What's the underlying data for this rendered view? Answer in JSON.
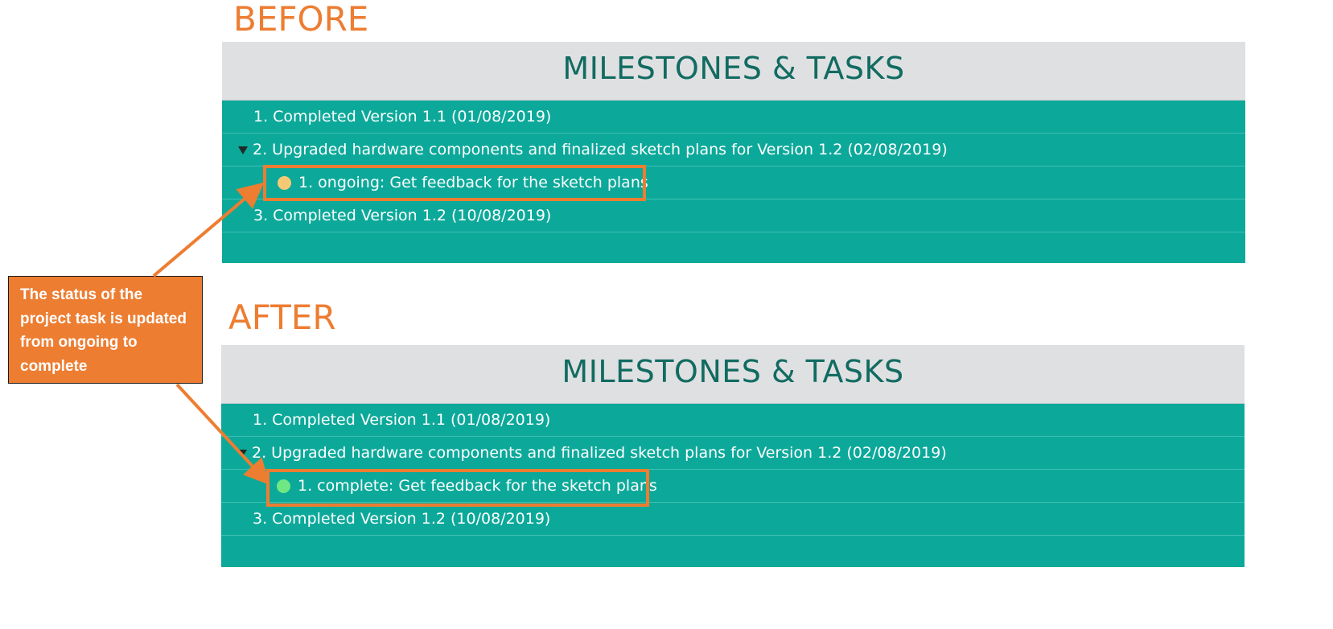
{
  "before": {
    "label": "BEFORE",
    "panel_title": "MILESTONES & TASKS",
    "rows": [
      {
        "text": "1. Completed Version 1.1 (01/08/2019)"
      },
      {
        "text": "2. Upgraded hardware components and finalized sketch plans for Version 1.2 (02/08/2019)",
        "expanded": true
      },
      {
        "text": "1. ongoing: Get feedback for the sketch plans",
        "status": "ongoing",
        "status_color": "#f8c974"
      },
      {
        "text": "3. Completed Version 1.2 (10/08/2019)"
      }
    ]
  },
  "after": {
    "label": "AFTER",
    "panel_title": "MILESTONES & TASKS",
    "rows": [
      {
        "text": "1. Completed Version 1.1 (01/08/2019)"
      },
      {
        "text": "2. Upgraded hardware components and finalized sketch plans for Version 1.2 (02/08/2019)",
        "expanded": true
      },
      {
        "text": "1. complete: Get feedback for the sketch plans",
        "status": "complete",
        "status_color": "#6fe884"
      },
      {
        "text": "3. Completed Version 1.2 (10/08/2019)"
      }
    ]
  },
  "callout": {
    "text": "The status of the project task is updated from ongoing to complete"
  },
  "colors": {
    "accent": "#ed7d31",
    "panel_bg": "#0ca99a",
    "header_bg": "#dfe0e2",
    "title_color": "#116b61"
  },
  "icons": {
    "disclosure": "triangle-down-icon",
    "status": "status-dot-icon",
    "arrow": "arrow-icon"
  }
}
